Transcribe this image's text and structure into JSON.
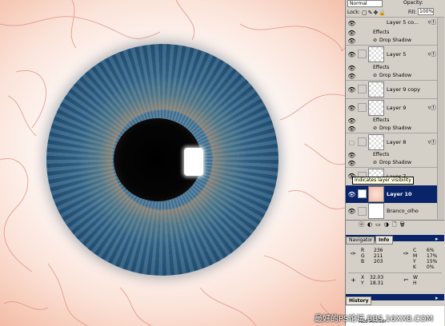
{
  "layers_panel": {
    "blend_mode": "Normal",
    "opacity_label": "Opacity:",
    "lock_label": "Lock:",
    "fill_label": "Fill:",
    "fill_value": "100%",
    "layers": [
      {
        "name": "Layer 5 co...",
        "fx": true
      },
      {
        "effects": "Effects",
        "drop_shadow": "Drop Shadow"
      },
      {
        "name": "Layer 5",
        "fx": true
      },
      {
        "effects": "Effects",
        "drop_shadow": "Drop Shadow"
      },
      {
        "name": "Layer 9 copy"
      },
      {
        "name": "Layer 9",
        "fx": true
      },
      {
        "effects": "Effects",
        "drop_shadow": "Drop Shadow"
      },
      {
        "name": "Layer 8",
        "fx": true
      },
      {
        "effects": "Effects",
        "drop_shadow": "Drop Shadow"
      },
      {
        "name": "Layer 7"
      },
      {
        "name": "Layer 10",
        "selected": true
      },
      {
        "name": "Branco_olho"
      }
    ],
    "tooltip": "Indicates layer visibility"
  },
  "info_panel": {
    "tabs": [
      "Navigator",
      "Info"
    ],
    "rgb": {
      "R": "236",
      "G": "211",
      "B": "203"
    },
    "cmyk": {
      "C": "6%",
      "M": "17%",
      "Y": "15%",
      "K": "0%"
    },
    "xy": {
      "X": "32.03",
      "Y": "18.31"
    },
    "wh": {
      "W": "",
      "H": ""
    }
  },
  "history_panel": {
    "tab": "History",
    "item": "Add Anchor"
  },
  "watermark": "最好的PS论坛 BBS.16XX8.COM"
}
